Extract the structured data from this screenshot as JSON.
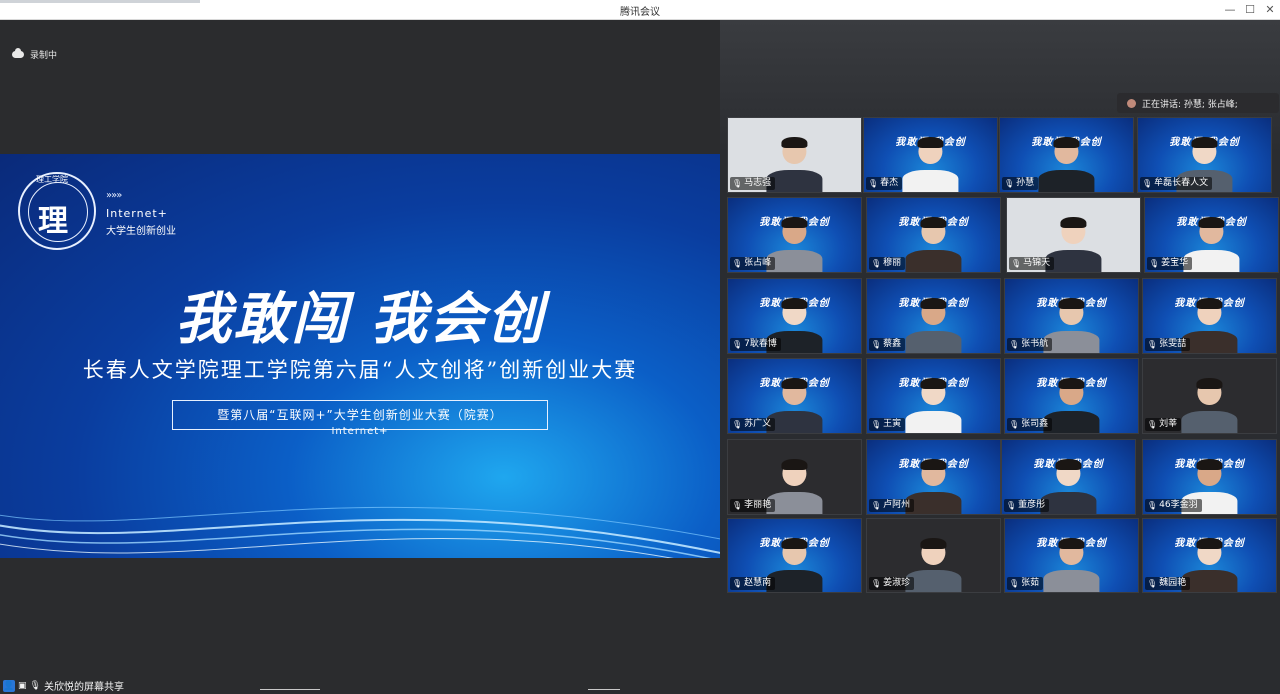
{
  "window": {
    "title": "腾讯会议"
  },
  "recording": {
    "label": "录制中"
  },
  "slide": {
    "logo_top_text": "理工学院",
    "logo_glyph": "理",
    "arrows": "»»»",
    "brand_line1": "Internet+",
    "brand_line2": "大学生创新创业",
    "headline": "我敢闯  我会创",
    "subtitle": "长春人文学院理工学院第六届“人文创将”创新创业大赛",
    "boxed": "暨第八届“互联网+”大学生创新创业大赛（院赛）",
    "footer": "Internet+"
  },
  "speaking": {
    "label": "正在讲话: 孙慧; 张占峰;"
  },
  "participants": [
    {
      "name": "马志强",
      "style": "white"
    },
    {
      "name": "春杰",
      "style": "blue"
    },
    {
      "name": "孙慧",
      "style": "blue"
    },
    {
      "name": "牟磊长春人文",
      "style": "blue"
    },
    {
      "name": "张占峰",
      "style": "blue"
    },
    {
      "name": "穆丽",
      "style": "blue"
    },
    {
      "name": "马锦天",
      "style": "white"
    },
    {
      "name": "姜宝华",
      "style": "blue"
    },
    {
      "name": "7耿春博",
      "style": "blue"
    },
    {
      "name": "蔡鑫",
      "style": "blue"
    },
    {
      "name": "张书航",
      "style": "blue"
    },
    {
      "name": "张雯喆",
      "style": "blue"
    },
    {
      "name": "苏广义",
      "style": "blue"
    },
    {
      "name": "王寅",
      "style": "blue"
    },
    {
      "name": "张司鑫",
      "style": "blue"
    },
    {
      "name": "刘莘",
      "style": "dark"
    },
    {
      "name": "李丽艳",
      "style": "dark"
    },
    {
      "name": "卢阿州",
      "style": "blue"
    },
    {
      "name": "董彦彤",
      "style": "blue"
    },
    {
      "name": "46李金羽",
      "style": "blue"
    },
    {
      "name": "赵慧南",
      "style": "blue"
    },
    {
      "name": "姜淑珍",
      "style": "dark"
    },
    {
      "name": "张茹",
      "style": "blue"
    },
    {
      "name": "魏园艳",
      "style": "blue"
    }
  ],
  "slide_word": "我敢闯  我会创",
  "share": {
    "label": "关欣悦的屏幕共享"
  }
}
